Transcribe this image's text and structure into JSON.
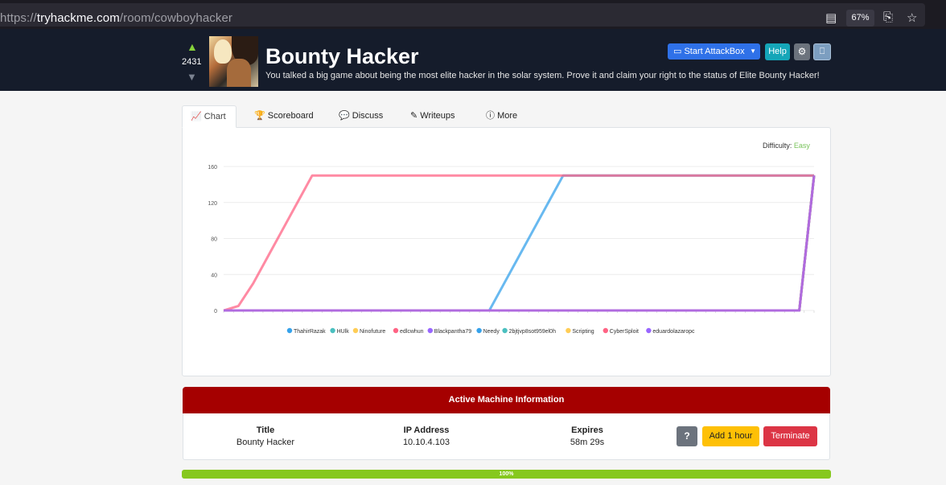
{
  "browser": {
    "url_prefix": "https://",
    "url_host": "tryhackme.com",
    "url_path": "/room/cowboyhacker",
    "zoom": "67%"
  },
  "room": {
    "votes": "2431",
    "title": "Bounty Hacker",
    "description": "You talked a big game about being the most elite hacker in the solar system. Prove it and claim your right to the status of Elite Bounty Hacker!",
    "buttons": {
      "attackbox": "Start AttackBox",
      "help": "Help"
    }
  },
  "tabs": [
    "Chart",
    "Scoreboard",
    "Discuss",
    "Writeups",
    "More"
  ],
  "difficulty": {
    "label": "Difficulty:",
    "value": "Easy",
    "color": "#78c35a"
  },
  "chart_data": {
    "type": "line",
    "title": "",
    "xlabel": "",
    "ylabel": "",
    "ylim": [
      0,
      160
    ],
    "y_ticks": [
      "0",
      "40",
      "80",
      "120",
      "160"
    ],
    "grid": true,
    "legend_placement": "bottom",
    "x": [
      0,
      5,
      10,
      15,
      20,
      25,
      30,
      35,
      40,
      45,
      50,
      55,
      60,
      65,
      70,
      75,
      80,
      85,
      90,
      95,
      100,
      105,
      110,
      115,
      120,
      125,
      130,
      135,
      140,
      145,
      150,
      155,
      160,
      165,
      170,
      175,
      180,
      185,
      190,
      195,
      200
    ],
    "series": [
      {
        "name": "ThahirRazak",
        "color": "#36a2eb",
        "values": [
          0,
          0,
          0,
          0,
          0,
          0,
          0,
          0,
          0,
          0,
          0,
          0,
          0,
          0,
          0,
          0,
          0,
          0,
          0,
          30,
          60,
          90,
          120,
          150,
          150,
          150,
          150,
          150,
          150,
          150,
          150,
          150,
          150,
          150,
          150,
          150,
          150,
          150,
          150,
          150,
          150
        ]
      },
      {
        "name": "HUlk",
        "color": "#4bc0c0",
        "values": [
          0,
          0,
          0,
          0,
          0,
          0,
          0,
          0,
          0,
          0,
          0,
          0,
          0,
          0,
          0,
          0,
          0,
          0,
          0,
          0,
          0,
          0,
          0,
          0,
          0,
          0,
          0,
          0,
          0,
          0,
          0,
          0,
          0,
          0,
          0,
          0,
          0,
          0,
          0,
          0,
          150
        ]
      },
      {
        "name": "Ninofuture",
        "color": "#ffcd56",
        "values": [
          0,
          0,
          0,
          0,
          0,
          0,
          0,
          0,
          0,
          0,
          0,
          0,
          0,
          0,
          0,
          0,
          0,
          0,
          0,
          0,
          0,
          0,
          0,
          0,
          0,
          0,
          0,
          0,
          0,
          0,
          0,
          0,
          0,
          0,
          0,
          0,
          0,
          0,
          0,
          0,
          150
        ]
      },
      {
        "name": "edlcwhun",
        "color": "#ff6384",
        "values": [
          0,
          5,
          30,
          60,
          90,
          120,
          150,
          150,
          150,
          150,
          150,
          150,
          150,
          150,
          150,
          150,
          150,
          150,
          150,
          150,
          150,
          150,
          150,
          150,
          150,
          150,
          150,
          150,
          150,
          150,
          150,
          150,
          150,
          150,
          150,
          150,
          150,
          150,
          150,
          150,
          150
        ]
      },
      {
        "name": "Blackpantha79",
        "color": "#9966ff",
        "values": [
          0,
          0,
          0,
          0,
          0,
          0,
          0,
          0,
          0,
          0,
          0,
          0,
          0,
          0,
          0,
          0,
          0,
          0,
          0,
          0,
          0,
          0,
          0,
          0,
          0,
          0,
          0,
          0,
          0,
          0,
          0,
          0,
          0,
          0,
          0,
          0,
          0,
          0,
          0,
          0,
          150
        ]
      },
      {
        "name": "Needy",
        "color": "#36a2eb",
        "values": [
          0,
          0,
          0,
          0,
          0,
          0,
          0,
          0,
          0,
          0,
          0,
          0,
          0,
          0,
          0,
          0,
          0,
          0,
          0,
          0,
          0,
          0,
          0,
          0,
          0,
          0,
          0,
          0,
          0,
          0,
          0,
          0,
          0,
          0,
          0,
          0,
          0,
          0,
          0,
          0,
          150
        ]
      },
      {
        "name": "2bjtjvp8sot959el0h",
        "color": "#4bc0c0",
        "values": [
          0,
          0,
          0,
          0,
          0,
          0,
          0,
          0,
          0,
          0,
          0,
          0,
          0,
          0,
          0,
          0,
          0,
          0,
          0,
          0,
          0,
          0,
          0,
          0,
          0,
          0,
          0,
          0,
          0,
          0,
          0,
          0,
          0,
          0,
          0,
          0,
          0,
          0,
          0,
          0,
          150
        ]
      },
      {
        "name": "Scripting",
        "color": "#ffcd56",
        "values": [
          0,
          0,
          0,
          0,
          0,
          0,
          0,
          0,
          0,
          0,
          0,
          0,
          0,
          0,
          0,
          0,
          0,
          0,
          0,
          0,
          0,
          0,
          0,
          0,
          0,
          0,
          0,
          0,
          0,
          0,
          0,
          0,
          0,
          0,
          0,
          0,
          0,
          0,
          0,
          0,
          150
        ]
      },
      {
        "name": "CyberSploit",
        "color": "#ff6384",
        "values": [
          0,
          0,
          0,
          0,
          0,
          0,
          0,
          0,
          0,
          0,
          0,
          0,
          0,
          0,
          0,
          0,
          0,
          0,
          0,
          0,
          0,
          0,
          0,
          0,
          0,
          0,
          0,
          0,
          0,
          0,
          0,
          0,
          0,
          0,
          0,
          0,
          0,
          0,
          0,
          0,
          150
        ]
      },
      {
        "name": "eduardolazaropc",
        "color": "#9966ff",
        "values": [
          0,
          0,
          0,
          0,
          0,
          0,
          0,
          0,
          0,
          0,
          0,
          0,
          0,
          0,
          0,
          0,
          0,
          0,
          0,
          0,
          0,
          0,
          0,
          0,
          0,
          0,
          0,
          0,
          0,
          0,
          0,
          0,
          0,
          0,
          0,
          0,
          0,
          0,
          0,
          0,
          150
        ]
      }
    ]
  },
  "active_machine": {
    "header": "Active Machine Information",
    "columns": [
      {
        "label": "Title",
        "value": "Bounty Hacker"
      },
      {
        "label": "IP Address",
        "value": "10.10.4.103"
      },
      {
        "label": "Expires",
        "value": "58m 29s"
      }
    ],
    "buttons": {
      "help": "?",
      "add_hour": "Add 1 hour",
      "terminate": "Terminate"
    }
  },
  "progress": {
    "value": 100,
    "label": "100%"
  }
}
